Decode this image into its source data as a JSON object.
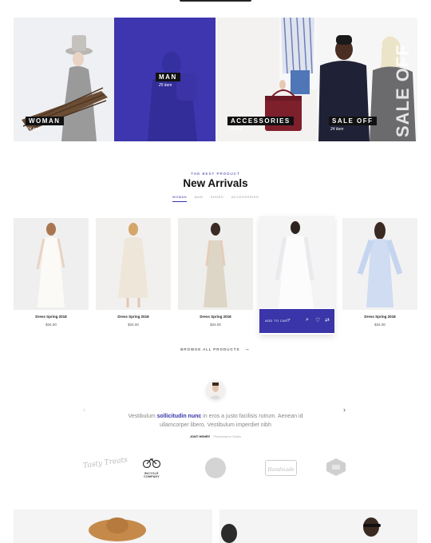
{
  "categories": [
    {
      "label": "WOMAN",
      "count": "24 item"
    },
    {
      "label": "MAN",
      "count": "25 item"
    },
    {
      "label": "ACCESSORIES",
      "count": "24 item"
    },
    {
      "label": "SALE OFF",
      "count": "24 item",
      "overlay": "SALE OFF"
    }
  ],
  "new_arrivals": {
    "eyebrow": "THE BEST PRODUCT",
    "title": "New Arrivals",
    "tabs": [
      "WOMAN",
      "MAN",
      "SHOES",
      "ACCESSORIES"
    ],
    "active_tab": "WOMAN",
    "products": [
      {
        "name": "Dress Spring 2018",
        "price": "$34.00"
      },
      {
        "name": "Dress Spring 2018",
        "price": "$34.00"
      },
      {
        "name": "Dress Spring 2018",
        "price": "$34.00"
      },
      {
        "name": "Dress Spring 2018",
        "price": "$34.00",
        "add_to_cart": "ADD TO CART"
      },
      {
        "name": "Dress Spring 2018",
        "price": "$34.00"
      }
    ],
    "browse_label": "BROWSE ALL PRODUCTS"
  },
  "testimonial": {
    "text_before": "Vestibulum ",
    "text_highlight": "sollicitudin nunc",
    "text_after": " in eros a justo facilisis rutrum. Aenean id ullamcorper libero. Vestibulum imperdiet nibh",
    "author": "JONT HENRY",
    "role": "Photochamo Studio"
  },
  "brands": [
    {
      "name": "Tasty Treats"
    },
    {
      "name": "BICYCLE COMPANY"
    },
    {
      "name": ""
    },
    {
      "name": "Handmade"
    },
    {
      "name": ""
    }
  ],
  "colors": {
    "accent": "#3a35a8",
    "dark": "#111111"
  }
}
